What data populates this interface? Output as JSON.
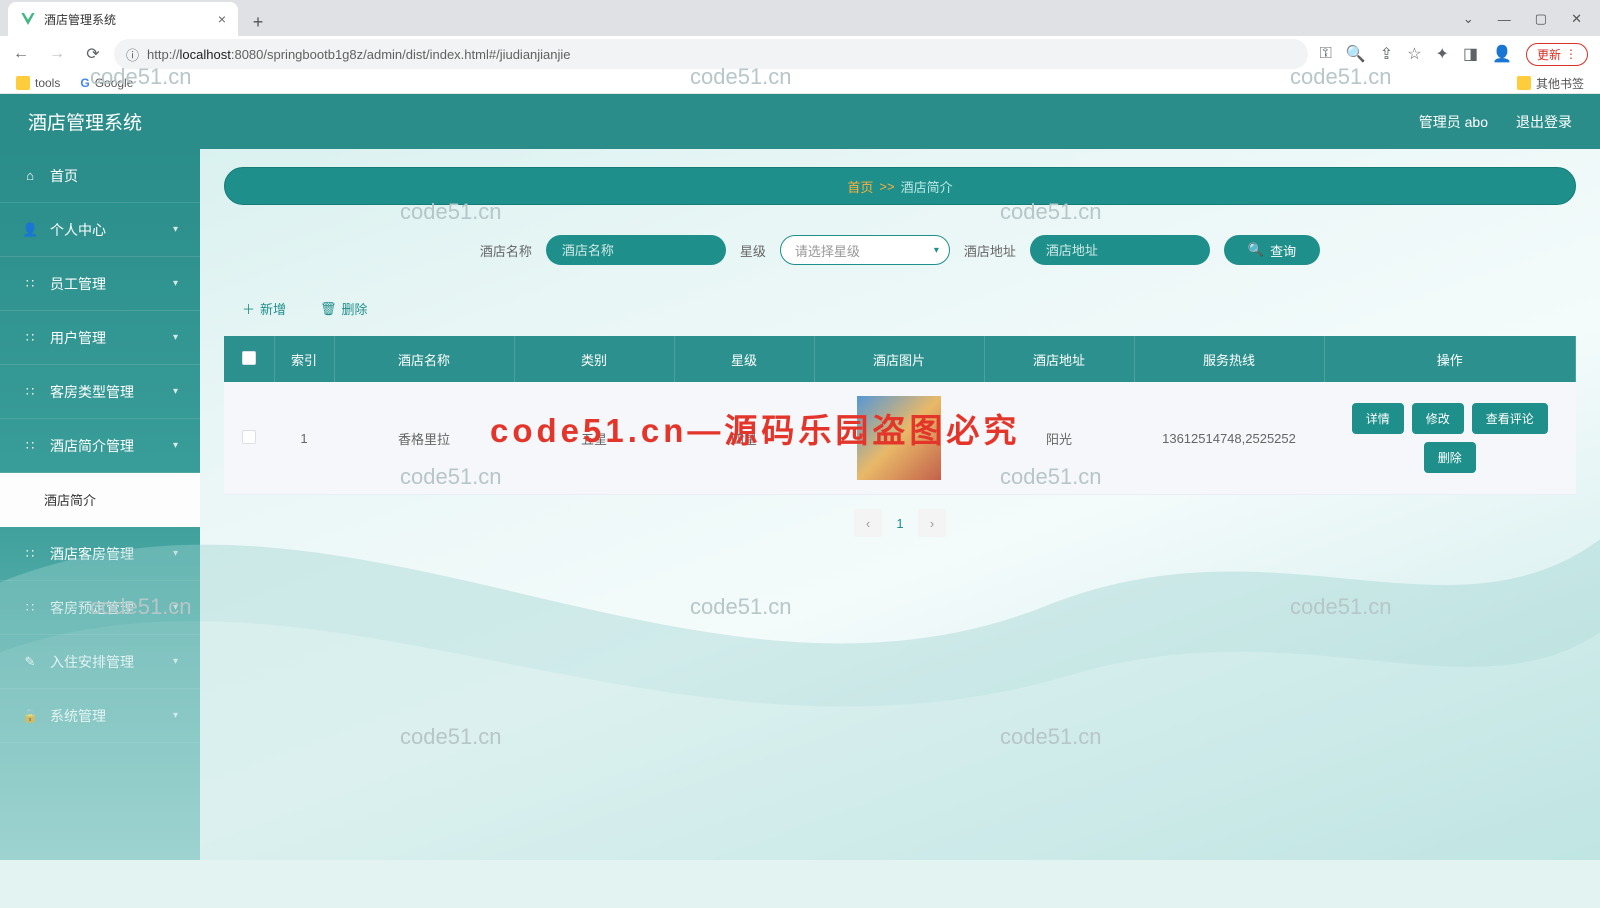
{
  "browser": {
    "tab_title": "酒店管理系统",
    "url_prefix": "http://",
    "url_host": "localhost",
    "url_path": ":8080/springbootb1g8z/admin/dist/index.html#/jiudianjianjie",
    "update_label": "更新",
    "bookmarks": {
      "tools": "tools",
      "google": "Google",
      "other": "其他书签"
    }
  },
  "header": {
    "app_title": "酒店管理系统",
    "admin_label": "管理员 abo",
    "logout_label": "退出登录"
  },
  "sidebar": [
    {
      "icon": "⌂",
      "label": "首页",
      "sub": false
    },
    {
      "icon": "👤",
      "label": "个人中心",
      "sub": true
    },
    {
      "icon": "∷",
      "label": "员工管理",
      "sub": true
    },
    {
      "icon": "∷",
      "label": "用户管理",
      "sub": true
    },
    {
      "icon": "∷",
      "label": "客房类型管理",
      "sub": true
    },
    {
      "icon": "∷",
      "label": "酒店简介管理",
      "sub": true
    },
    {
      "icon": "",
      "label": "酒店简介",
      "sub": false,
      "active": true
    },
    {
      "icon": "∷",
      "label": "酒店客房管理",
      "sub": true
    },
    {
      "icon": "∷",
      "label": "客房预定管理",
      "sub": true
    },
    {
      "icon": "✎",
      "label": "入住安排管理",
      "sub": true
    },
    {
      "icon": "🔒",
      "label": "系统管理",
      "sub": true
    }
  ],
  "breadcrumb": {
    "home": "首页",
    "sep": ">>",
    "current": "酒店简介"
  },
  "filters": {
    "name_label": "酒店名称",
    "name_placeholder": "酒店名称",
    "star_label": "星级",
    "star_placeholder": "请选择星级",
    "addr_label": "酒店地址",
    "addr_placeholder": "酒店地址",
    "search_label": "查询"
  },
  "actions": {
    "add": "新增",
    "delete": "删除"
  },
  "table": {
    "headers": [
      "索引",
      "酒店名称",
      "类别",
      "星级",
      "酒店图片",
      "酒店地址",
      "服务热线",
      "操作"
    ],
    "row": {
      "index": "1",
      "name": "香格里拉",
      "category": "五星",
      "star": "四星",
      "addr": "阳光",
      "hotline": "13612514748,2525252"
    },
    "ops": {
      "detail": "详情",
      "edit": "修改",
      "comments": "查看评论",
      "delete": "删除"
    }
  },
  "pagination": {
    "current": "1"
  },
  "watermark": "code51.cn",
  "watermark_red": "code51.cn—源码乐园盗图必究"
}
